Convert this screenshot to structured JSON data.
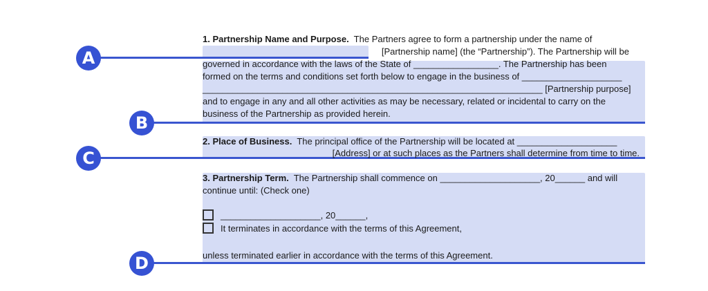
{
  "markers": [
    "A",
    "B",
    "C",
    "D"
  ],
  "colors": {
    "highlight": "#d5dcf5",
    "accent": "#3652d3"
  },
  "section1": {
    "heading": "1.  Partnership Name and Purpose.",
    "l1": "  The Partners agree to form a partnership under the name of",
    "l2": "[Partnership name] (the “Partnership”). The Partnership will be",
    "l3": "governed in accordance with the laws of the State of _________________. The Partnership has been",
    "l4": "formed on the terms and conditions set forth below to engage in the business of ____________________",
    "l5": "____________________________________________________________________ [Partnership purpose]",
    "l6": "and to engage in any and all other activities as may be necessary, related or incidental to carry on the",
    "l7": "business of the Partnership as provided herein."
  },
  "section2": {
    "heading": "2.  Place of Business.",
    "l1": "  The principal office of the Partnership will be located at ____________________",
    "l2": "[Address] or at such places as the Partners shall determine from time to time."
  },
  "section3": {
    "heading": "3.  Partnership Term.",
    "l1": "  The Partnership shall commence on ____________________, 20______ and will",
    "l2": "continue until: (Check one)",
    "option1": "____________________, 20______,",
    "option2": "It terminates in accordance with the terms of this Agreement,",
    "l3": "unless terminated earlier in accordance with the terms of this Agreement."
  }
}
